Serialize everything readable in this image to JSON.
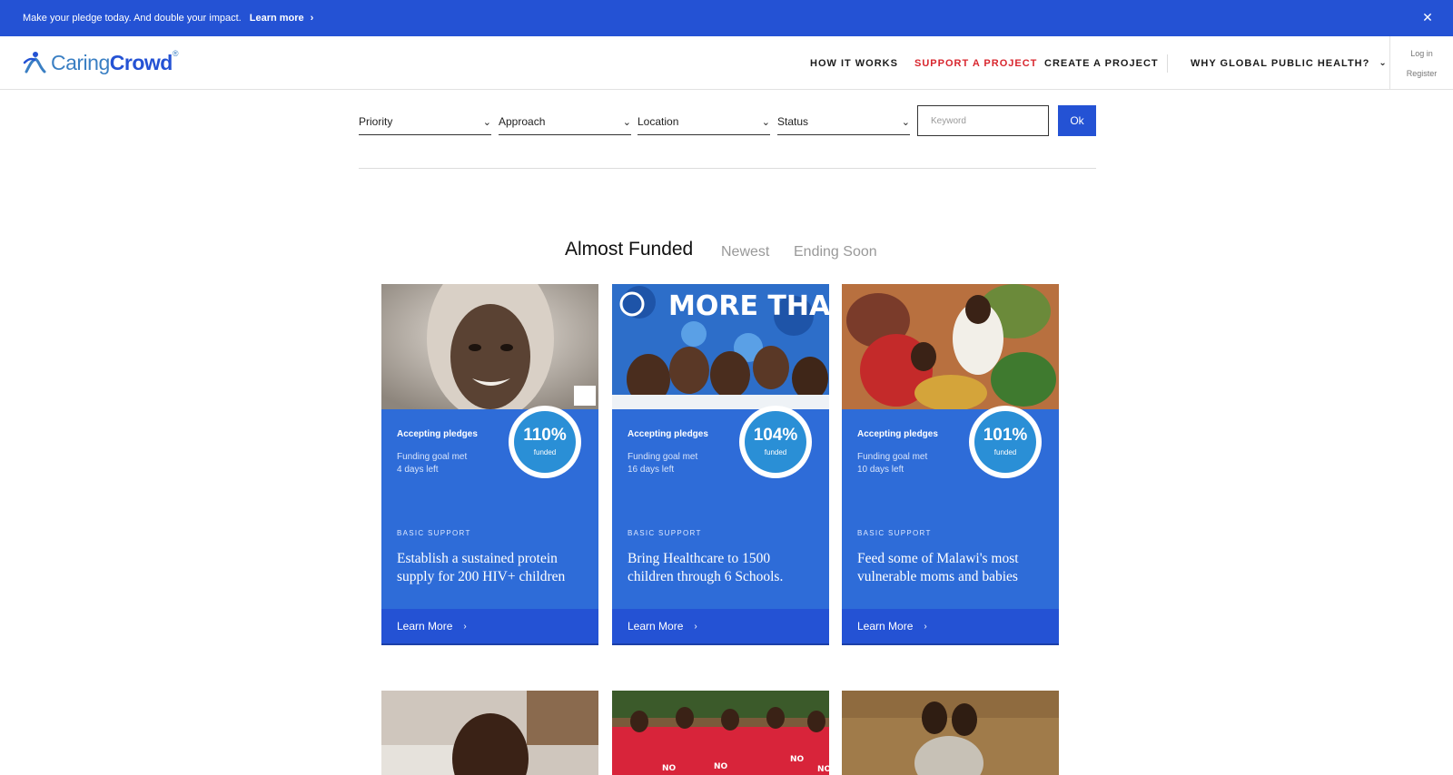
{
  "banner": {
    "message": "Make your pledge today. And double your impact.",
    "link_label": "Learn more",
    "chevron_icon": "chevron-right-icon",
    "close_icon": "close-icon"
  },
  "header": {
    "logo": {
      "word1": "Caring",
      "word2": "Crowd",
      "mark": "®"
    },
    "nav": {
      "how_it_works": "HOW IT WORKS",
      "support_project": "SUPPORT A PROJECT",
      "create_project": "CREATE A PROJECT",
      "why_gph": "WHY GLOBAL PUBLIC HEALTH?"
    },
    "auth": {
      "login": "Log in",
      "register": "Register"
    }
  },
  "filters": {
    "priority": "Priority",
    "approach": "Approach",
    "location": "Location",
    "status": "Status",
    "keyword_placeholder": "Keyword",
    "ok_label": "Ok"
  },
  "tabs": {
    "almost_funded": "Almost Funded",
    "newest": "Newest",
    "ending_soon": "Ending Soon"
  },
  "projects": [
    {
      "status": "Accepting pledges",
      "goal": "Funding goal met",
      "days_left": "4 days left",
      "percent": "110%",
      "funded_label": "funded",
      "category": "BASIC SUPPORT",
      "title": "Establish a sustained protein supply for 200 HIV+ children",
      "cta": "Learn More"
    },
    {
      "status": "Accepting pledges",
      "goal": "Funding goal met",
      "days_left": "16 days left",
      "percent": "104%",
      "funded_label": "funded",
      "category": "BASIC SUPPORT",
      "title": "Bring Healthcare to 1500 children through 6 Schools.",
      "cta": "Learn More",
      "photo_text": "MORE THAN ME"
    },
    {
      "status": "Accepting pledges",
      "goal": "Funding goal met",
      "days_left": "10 days left",
      "percent": "101%",
      "funded_label": "funded",
      "category": "BASIC SUPPORT",
      "title": "Feed some of Malawi's most vulnerable moms and babies",
      "cta": "Learn More"
    }
  ],
  "row2_photo_text": {
    "shirt": "NO"
  },
  "colors": {
    "brand_blue": "#2452d4",
    "card_blue": "#2e6cd8",
    "ring_blue": "#2a8fd6",
    "accent_red": "#d8262e"
  }
}
